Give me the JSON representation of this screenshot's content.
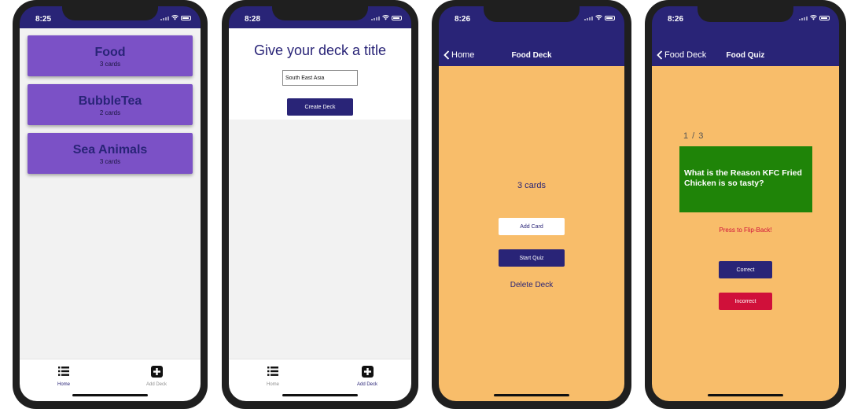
{
  "colors": {
    "primary": "#292477",
    "deck_card": "#7b51c6",
    "quiz_bg": "#f8bd6a",
    "question_card": "#1f8408",
    "incorrect": "#d0103a"
  },
  "screens": {
    "decks_list": {
      "status_time": "8:25",
      "decks": [
        {
          "title": "Food",
          "count": "3 cards"
        },
        {
          "title": "BubbleTea",
          "count": "2 cards"
        },
        {
          "title": "Sea Animals",
          "count": "3 cards"
        }
      ],
      "tabs": {
        "home": "Home",
        "add": "Add Deck",
        "active": "home"
      }
    },
    "add_deck": {
      "status_time": "8:28",
      "heading": "Give your deck a title",
      "input_value": "South East Asia",
      "create_label": "Create Deck",
      "tabs": {
        "home": "Home",
        "add": "Add Deck",
        "active": "add"
      }
    },
    "deck_detail": {
      "status_time": "8:26",
      "back_label": "Home",
      "title": "Food Deck",
      "card_count": "3 cards",
      "add_card_label": "Add Card",
      "start_quiz_label": "Start Quiz",
      "delete_label": "Delete Deck"
    },
    "quiz": {
      "status_time": "8:26",
      "back_label": "Food Deck",
      "title": "Food Quiz",
      "progress": "1 / 3",
      "question": "What is the Reason KFC Fried Chicken is so tasty?",
      "flip_label": "Press to Flip-Back!",
      "correct_label": "Correct",
      "incorrect_label": "Incorrect"
    }
  }
}
